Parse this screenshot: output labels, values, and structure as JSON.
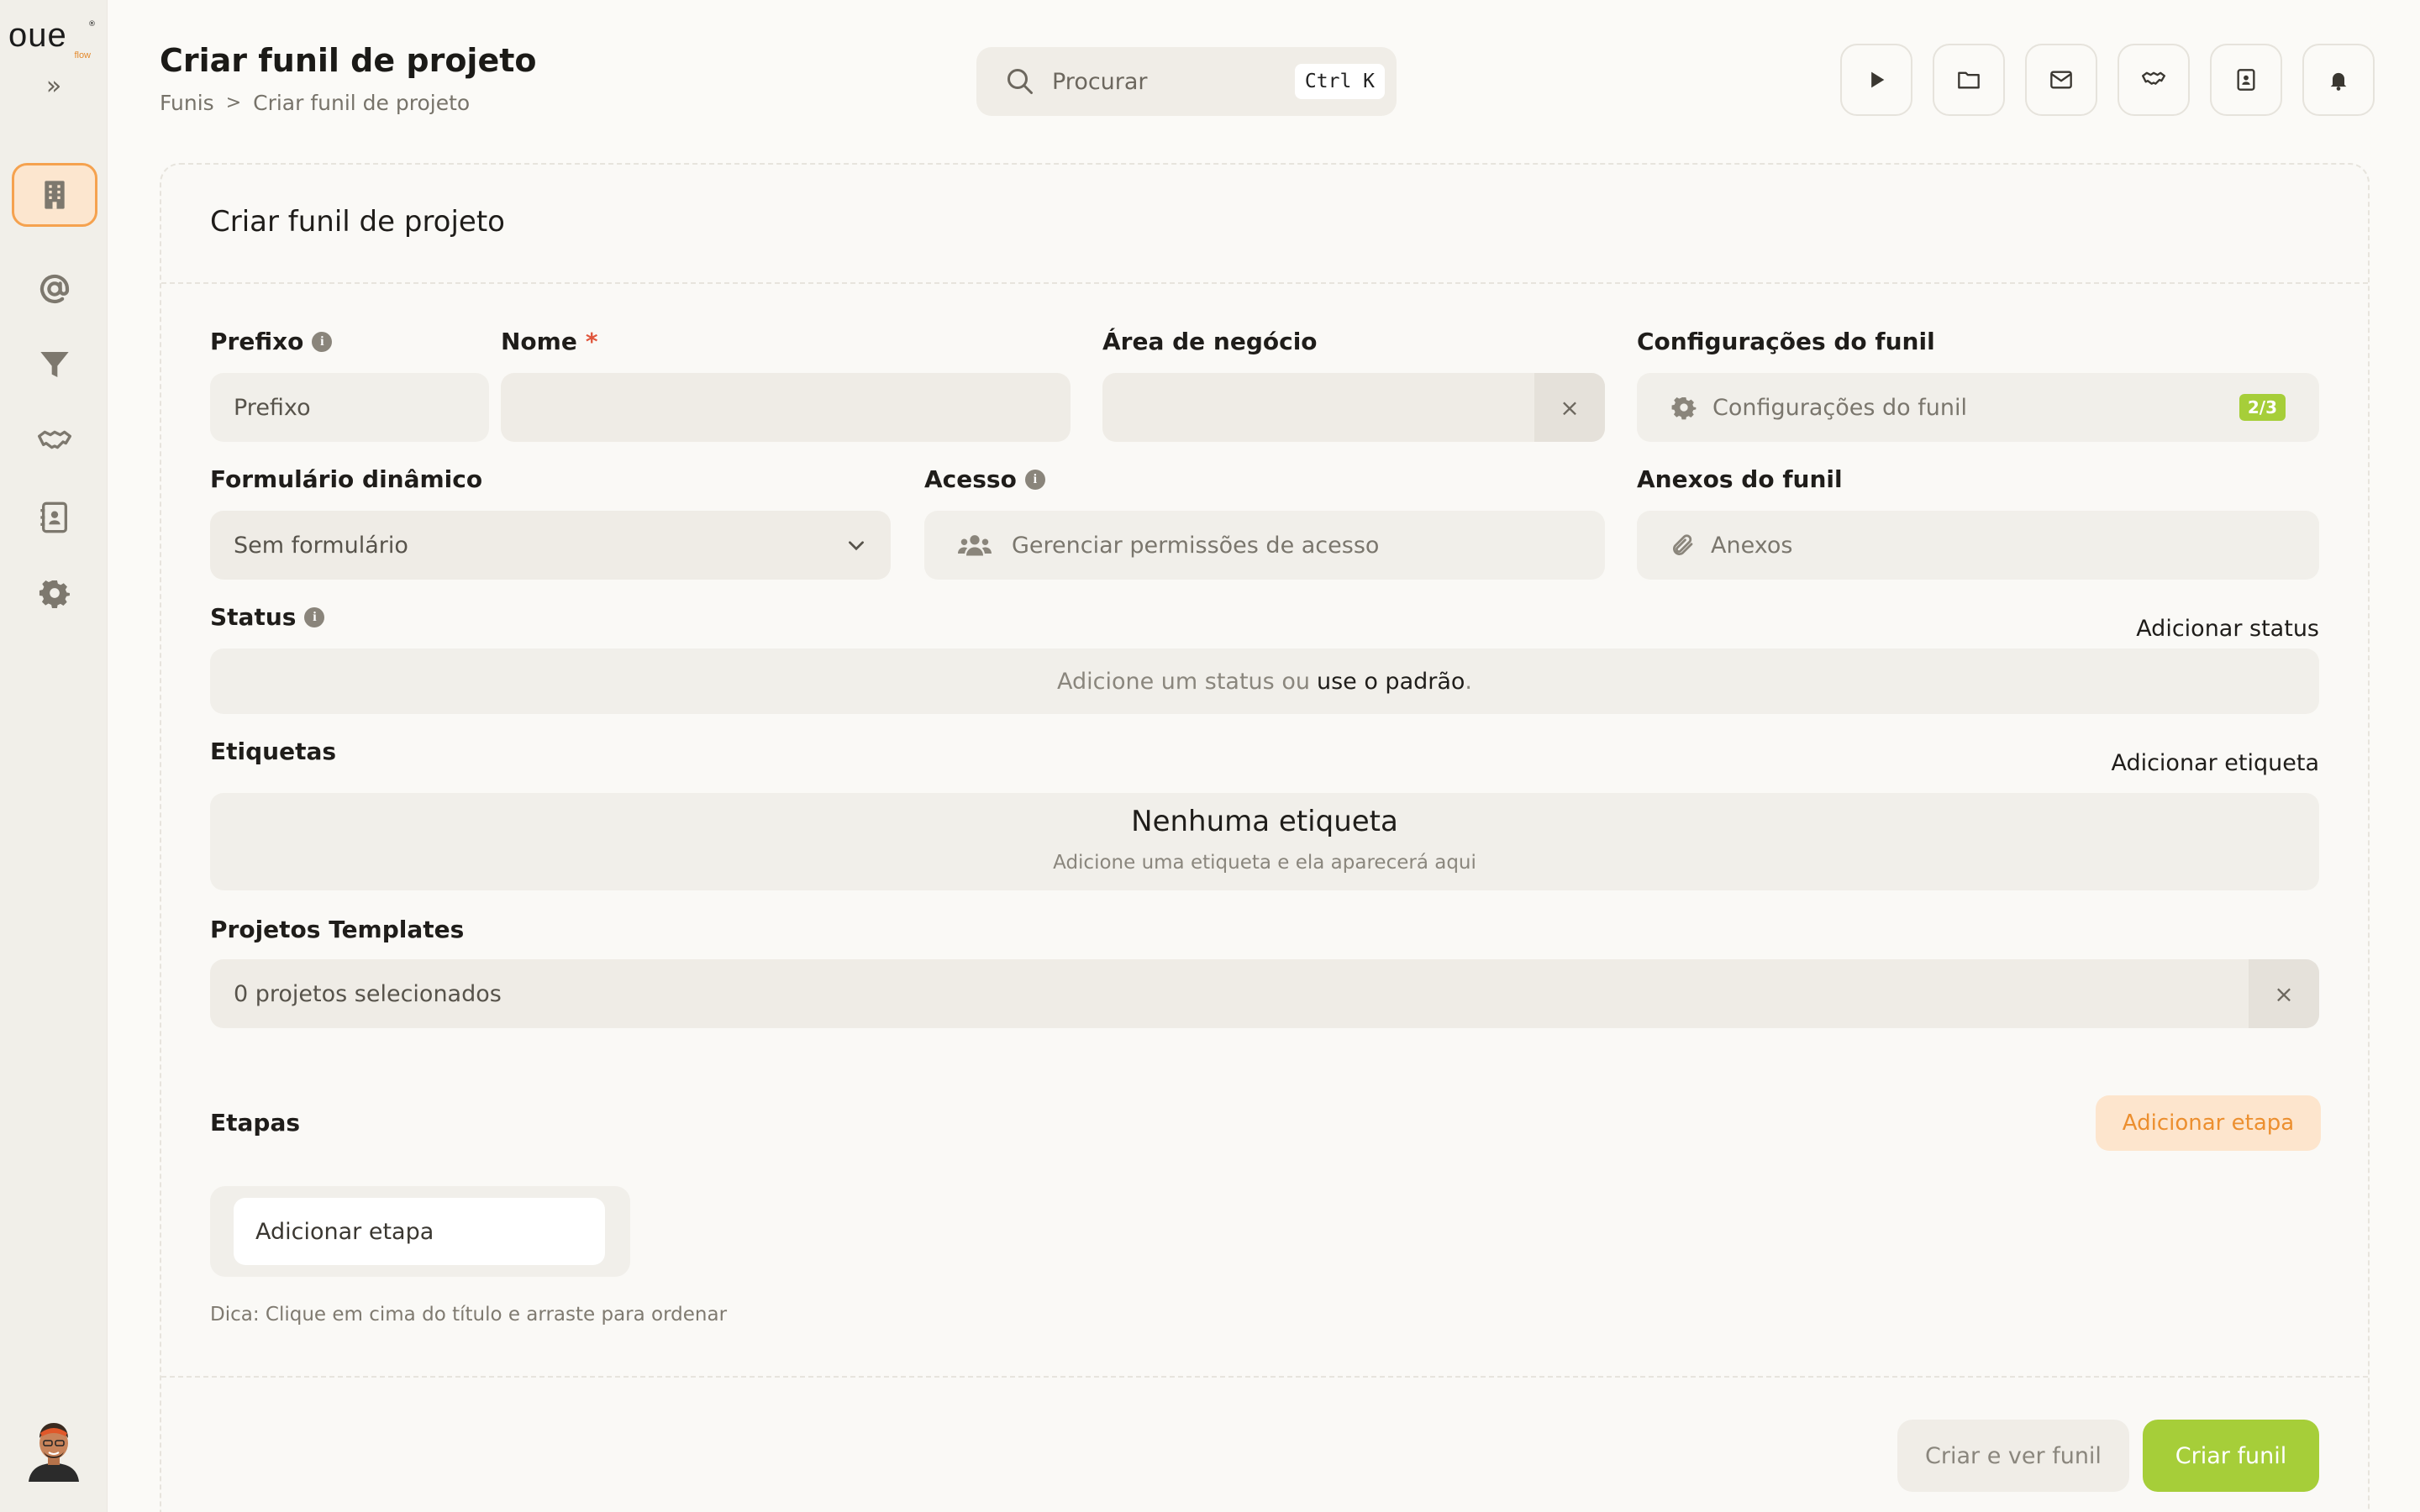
{
  "brand": {
    "logo_text": "OUE",
    "logo_sub": "flow",
    "logo_reg": "®"
  },
  "sidebar": {
    "expand_icon": "double-chevron-right",
    "items": [
      {
        "name": "building",
        "active": true
      },
      {
        "name": "at-sign"
      },
      {
        "name": "funnel"
      },
      {
        "name": "handshake"
      },
      {
        "name": "contact-book"
      },
      {
        "name": "gear"
      }
    ]
  },
  "header": {
    "title": "Criar funil de projeto",
    "breadcrumb": {
      "parent": "Funis",
      "separator": ">",
      "current": "Criar funil de projeto"
    },
    "search": {
      "placeholder": "Procurar",
      "shortcut": "Ctrl K"
    },
    "actions": [
      "play",
      "folder",
      "mail",
      "handshake",
      "contact-book",
      "bell"
    ]
  },
  "form": {
    "card_title": "Criar funil de projeto",
    "prefix": {
      "label": "Prefixo",
      "placeholder": "Prefixo"
    },
    "name": {
      "label": "Nome",
      "required_mark": "*",
      "value": ""
    },
    "business_area": {
      "label": "Área de negócio",
      "value": "",
      "clear": "×"
    },
    "funnel_settings": {
      "label": "Configurações do funil",
      "text": "Configurações do funil",
      "badge": "2/3"
    },
    "dynamic_form": {
      "label": "Formulário dinâmico",
      "value": "Sem formulário"
    },
    "access": {
      "label": "Acesso",
      "text": "Gerenciar permissões de acesso"
    },
    "attachments": {
      "label": "Anexos do funil",
      "text": "Anexos"
    },
    "status": {
      "label": "Status",
      "add_link": "Adicionar status",
      "empty_prefix": "Adicione um status ou",
      "empty_link": "use o padrão",
      "empty_suffix": "."
    },
    "tags": {
      "label": "Etiquetas",
      "add_link": "Adicionar etiqueta",
      "empty_title": "Nenhuma etiqueta",
      "empty_sub": "Adicione uma etiqueta e ela aparecerá aqui"
    },
    "templates": {
      "label": "Projetos Templates",
      "value": "0 projetos selecionados",
      "clear": "×"
    },
    "stages": {
      "label": "Etapas",
      "add_button": "Adicionar etapa",
      "input_placeholder": "Adicionar etapa",
      "hint": "Dica: Clique em cima do título e arraste para ordenar"
    }
  },
  "footer": {
    "secondary": "Criar e ver funil",
    "primary": "Criar funil"
  },
  "colors": {
    "accent_orange": "#f5a24f",
    "accent_green": "#a6ce39"
  }
}
